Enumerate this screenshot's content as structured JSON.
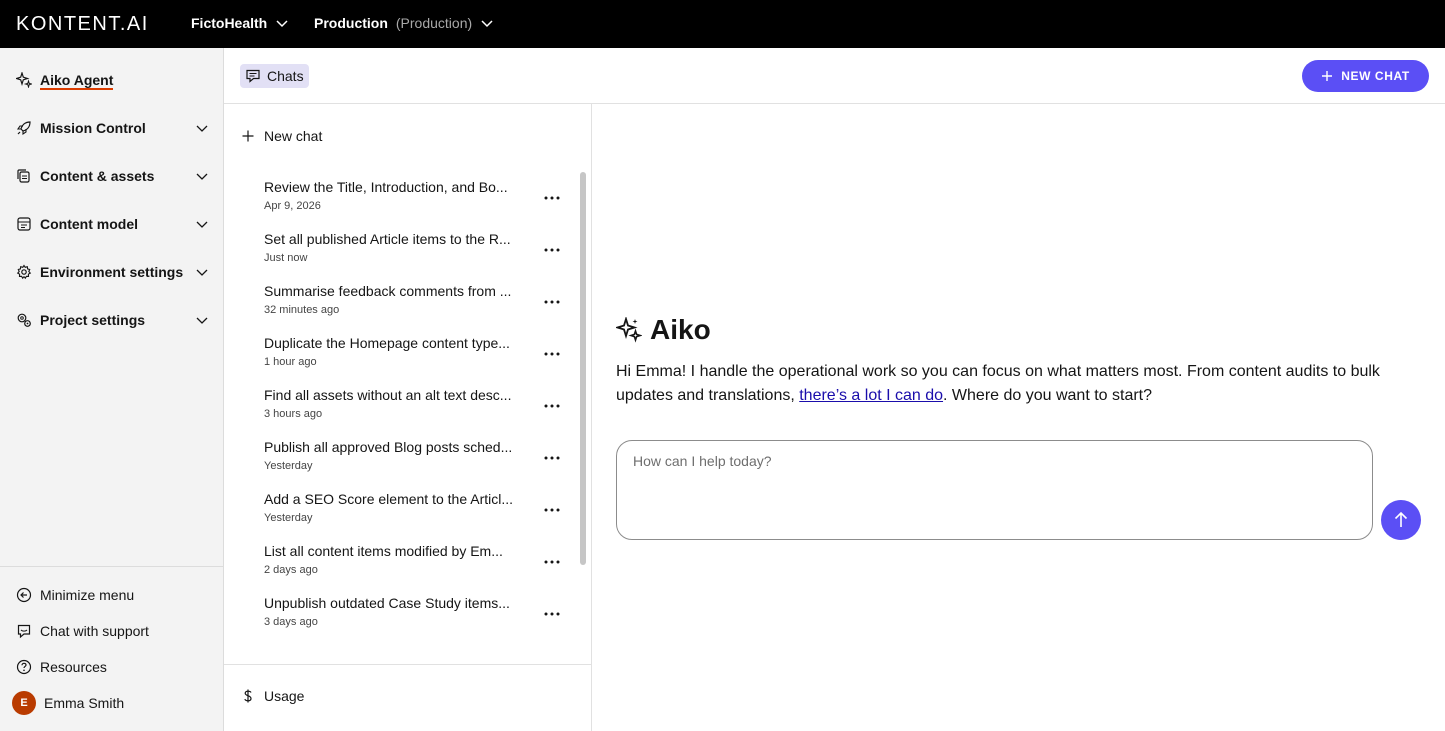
{
  "topbar": {
    "logo": "KONTENT.AI",
    "project": "FictoHealth",
    "environment": "Production",
    "environment_sub": "(Production)"
  },
  "nav": {
    "items": [
      {
        "label": "Aiko Agent",
        "icon": "sparkle-icon",
        "active": true
      },
      {
        "label": "Mission Control",
        "icon": "rocket-icon"
      },
      {
        "label": "Content & assets",
        "icon": "files-icon"
      },
      {
        "label": "Content model",
        "icon": "model-icon"
      },
      {
        "label": "Environment settings",
        "icon": "gear-icon"
      },
      {
        "label": "Project settings",
        "icon": "gears-icon"
      }
    ],
    "bottom": {
      "minimize": "Minimize menu",
      "support": "Chat with support",
      "resources": "Resources",
      "user_name": "Emma Smith",
      "user_initial": "E"
    }
  },
  "subheader": {
    "chats_tab": "Chats",
    "new_chat_button": "NEW CHAT"
  },
  "chat_list": {
    "new_chat": "New chat",
    "items": [
      {
        "title": "Review the Title, Introduction, and Bo...",
        "time": "Apr 9, 2026"
      },
      {
        "title": "Set all published Article items to the R...",
        "time": "Just now"
      },
      {
        "title": "Summarise feedback comments from ...",
        "time": "32 minutes ago"
      },
      {
        "title": "Duplicate the Homepage content type...",
        "time": "1 hour ago"
      },
      {
        "title": "Find all assets without an alt text desc...",
        "time": "3 hours ago"
      },
      {
        "title": "Publish all approved Blog posts sched...",
        "time": "Yesterday"
      },
      {
        "title": "Add a SEO Score element to the Articl...",
        "time": "Yesterday"
      },
      {
        "title": "List all content items modified by Em...",
        "time": "2 days ago"
      },
      {
        "title": "Unpublish outdated Case Study items...",
        "time": "3 days ago"
      }
    ],
    "usage": "Usage"
  },
  "main": {
    "title": "Aiko",
    "intro_before": "Hi Emma! I handle the operational work so you can focus on what matters most. From content audits to bulk updates and translations, ",
    "intro_link": "there’s a lot I can do",
    "intro_after": ". Where do you want to start?",
    "prompt_placeholder": "How can I help today?"
  },
  "colors": {
    "accent": "#5b4ff5",
    "active_underline": "#db3c00",
    "topbar": "#000000",
    "avatar": "#b93b00"
  }
}
